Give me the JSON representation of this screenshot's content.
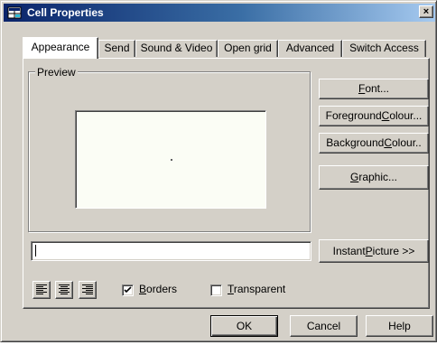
{
  "window": {
    "title": "Cell Properties",
    "close_glyph": "×"
  },
  "tabs": [
    {
      "label": "Appearance",
      "active": true
    },
    {
      "label": "Send"
    },
    {
      "label": "Sound & Video"
    },
    {
      "label": "Open grid"
    },
    {
      "label": "Advanced"
    },
    {
      "label": "Switch Access"
    }
  ],
  "preview": {
    "group_label": "Preview"
  },
  "side_buttons": {
    "font": {
      "pre": "",
      "key": "F",
      "post": "ont..."
    },
    "foreground": {
      "pre": "Foreground ",
      "key": "C",
      "post": "olour..."
    },
    "background": {
      "pre": "Background ",
      "key": "C",
      "post": "olour.."
    },
    "graphic": {
      "pre": "",
      "key": "G",
      "post": "raphic..."
    }
  },
  "cell_text": {
    "value": ""
  },
  "instant_picture": {
    "pre": "Instant ",
    "key": "P",
    "post": "icture >>"
  },
  "alignment": {
    "left": "align-left-icon",
    "center": "align-center-icon",
    "right": "align-right-icon"
  },
  "checkboxes": {
    "borders": {
      "pre": "",
      "key": "B",
      "post": "orders",
      "checked": true
    },
    "transparent": {
      "pre": "",
      "key": "T",
      "post": "ransparent",
      "checked": false
    }
  },
  "footer": {
    "ok": "OK",
    "cancel": "Cancel",
    "help": "Help"
  },
  "colors": {
    "dialog_bg": "#d4d0c8",
    "title_start": "#0a246a",
    "title_end": "#a6caf0",
    "preview_bg": "#fbfdf5"
  }
}
